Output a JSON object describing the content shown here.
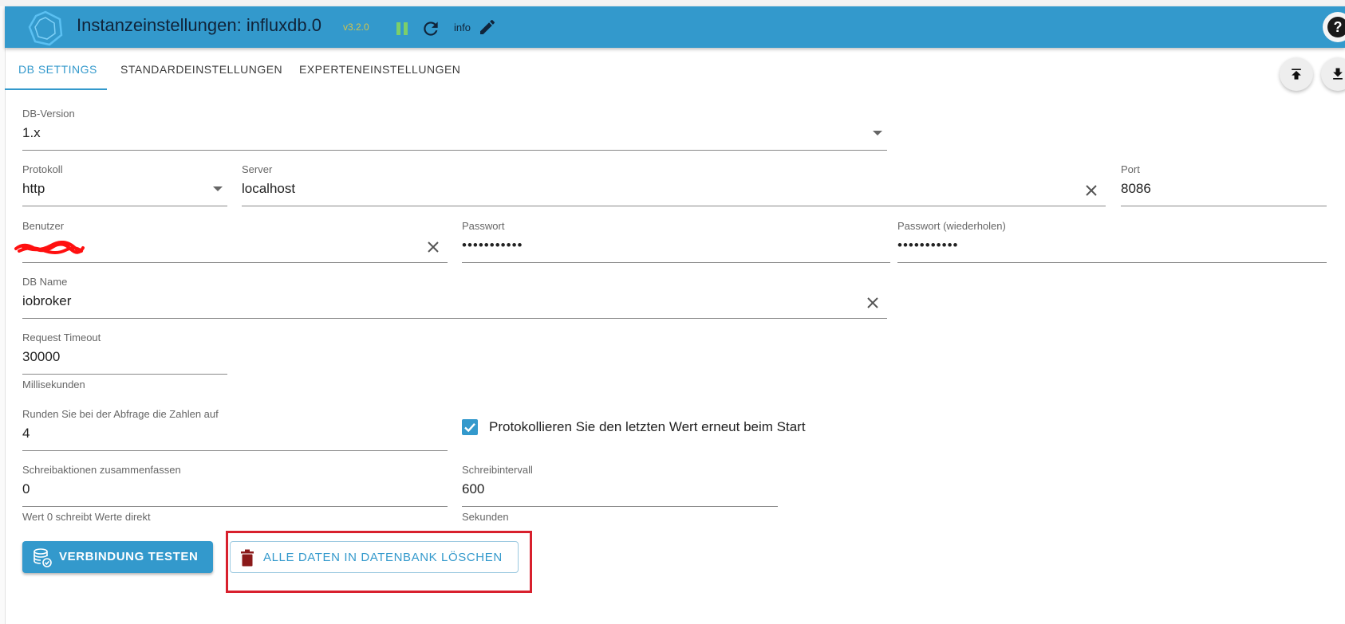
{
  "header": {
    "title": "Instanzeinstellungen: influxdb.0",
    "version": "v3.2.0",
    "info_label": "info"
  },
  "tabs": [
    {
      "label": "DB SETTINGS",
      "active": true
    },
    {
      "label": "STANDARDEINSTELLUNGEN",
      "active": false
    },
    {
      "label": "EXPERTENEINSTELLUNGEN",
      "active": false
    }
  ],
  "form": {
    "db_version": {
      "label": "DB-Version",
      "value": "1.x"
    },
    "protocol": {
      "label": "Protokoll",
      "value": "http"
    },
    "server": {
      "label": "Server",
      "value": "localhost"
    },
    "port": {
      "label": "Port",
      "value": "8086"
    },
    "user": {
      "label": "Benutzer",
      "value": ""
    },
    "password": {
      "label": "Passwort",
      "value": "•••••••••••"
    },
    "password_repeat": {
      "label": "Passwort (wiederholen)",
      "value": "•••••••••••"
    },
    "db_name": {
      "label": "DB Name",
      "value": "iobroker"
    },
    "request_timeout": {
      "label": "Request Timeout",
      "value": "30000",
      "helper": "Millisekunden"
    },
    "round": {
      "label": "Runden Sie bei der Abfrage die Zahlen auf",
      "value": "4"
    },
    "log_last_value": {
      "label": "Protokollieren Sie den letzten Wert erneut beim Start",
      "checked": true
    },
    "batch_writes": {
      "label": "Schreibaktionen zusammenfassen",
      "value": "0",
      "helper": "Wert 0 schreibt Werte direkt"
    },
    "write_interval": {
      "label": "Schreibintervall",
      "value": "600",
      "helper": "Sekunden"
    }
  },
  "buttons": {
    "test_connection": "VERBINDUNG TESTEN",
    "delete_all": "ALLE DATEN IN DATENBANK LÖSCHEN"
  },
  "colors": {
    "primary": "#3399cc",
    "highlight": "#d8202d",
    "delete_icon": "#8b1a1a"
  }
}
